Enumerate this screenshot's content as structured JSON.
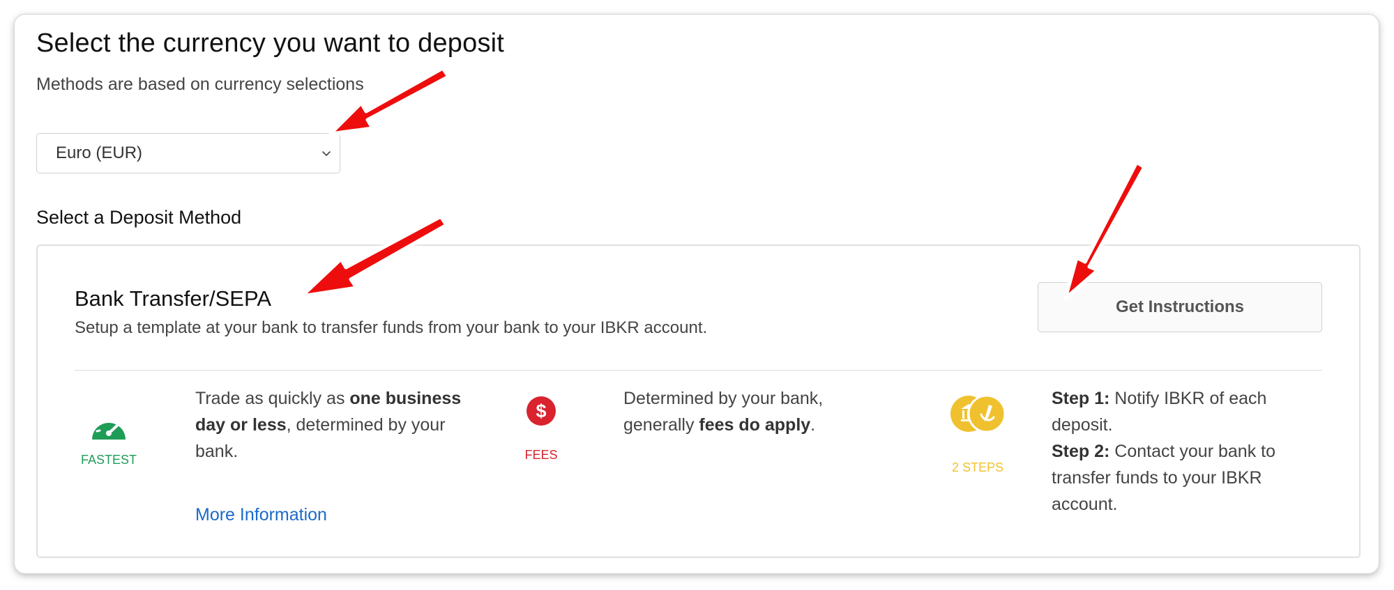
{
  "header": {
    "title": "Select the currency you want to deposit",
    "subtitle": "Methods are based on currency selections"
  },
  "currency_select": {
    "selected": "Euro (EUR)"
  },
  "deposit_section": {
    "title": "Select a Deposit Method"
  },
  "method": {
    "title": "Bank Transfer/SEPA",
    "description": "Setup a template at your bank to transfer funds from your bank to your IBKR account.",
    "button_label": "Get Instructions",
    "features": {
      "speed": {
        "label": "FASTEST",
        "text_pre": "Trade as quickly as ",
        "text_bold": "one business day or less",
        "text_post": ", determined by your bank.",
        "link": "More Information"
      },
      "fees": {
        "label": "FEES",
        "text_pre": "Determined by your bank, generally ",
        "text_bold": "fees do apply",
        "text_post": "."
      },
      "steps": {
        "label": "2 STEPS",
        "step1_label": "Step 1:",
        "step1_text": " Notify IBKR of each deposit.",
        "step2_label": "Step 2:",
        "step2_text": " Contact your bank to transfer funds to your IBKR account."
      }
    }
  },
  "colors": {
    "fastest": "#1e9d57",
    "fees": "#d9232e",
    "steps": "#f0c12e",
    "link": "#1b6ac9",
    "annotation_arrow": "#ee1111"
  },
  "icons": {
    "speed": "speedometer-icon",
    "fees": "dollar-icon",
    "steps": "steps-coins-icon",
    "select": "chevron-down-icon",
    "annotation": "red-arrow-icon"
  }
}
